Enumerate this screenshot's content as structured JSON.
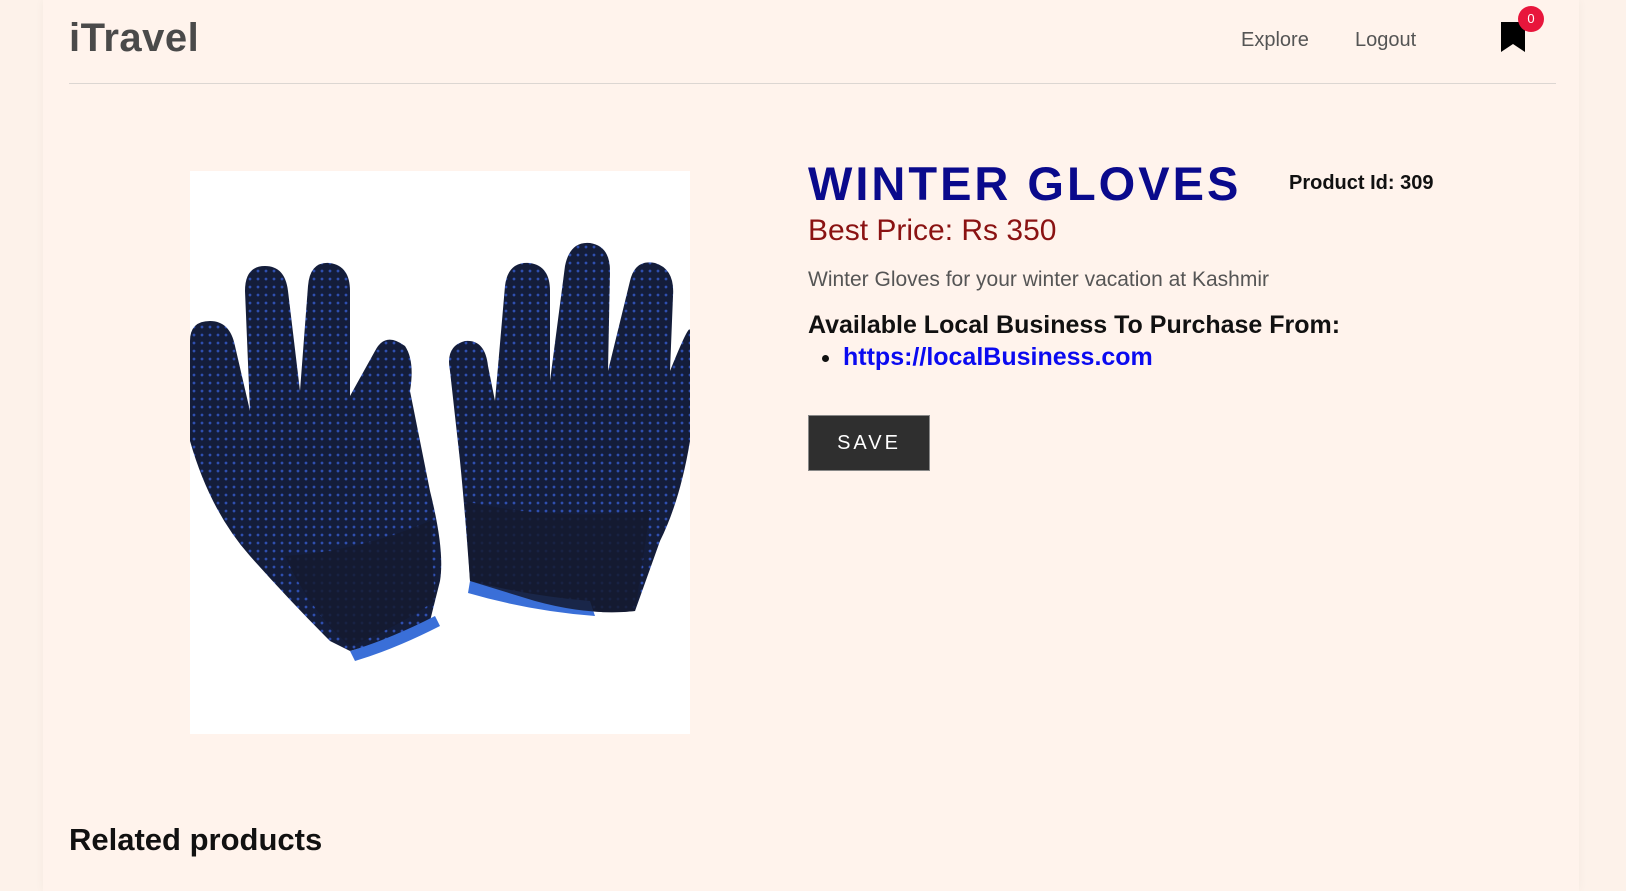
{
  "header": {
    "brand": "iTravel",
    "nav": {
      "explore": "Explore",
      "logout": "Logout"
    },
    "bookmark_icon": "bookmark-icon",
    "bookmark_count": "0",
    "badge_color": "#e8163c"
  },
  "product": {
    "title": "WINTER GLOVES",
    "id_label": "Product Id: 309",
    "price": "Best Price: Rs 350",
    "description": "Winter Gloves for your winter vacation at Kashmir",
    "available_heading": "Available Local Business To Purchase From:",
    "businesses": [
      "https://localBusiness.com"
    ],
    "save_label": "SAVE",
    "title_color": "#0a0a8c",
    "price_color": "#8a1212"
  },
  "related": {
    "title": "Related products"
  }
}
